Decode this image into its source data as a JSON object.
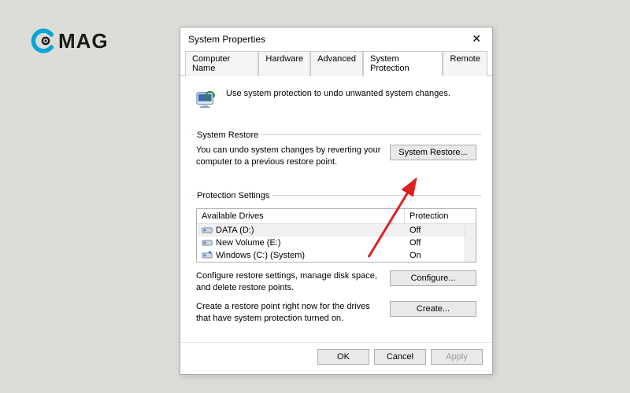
{
  "logo": {
    "text": "MAG"
  },
  "dialog": {
    "title": "System Properties",
    "tabs": [
      "Computer Name",
      "Hardware",
      "Advanced",
      "System Protection",
      "Remote"
    ],
    "active_tab": 3,
    "intro_text": "Use system protection to undo unwanted system changes.",
    "restore": {
      "group_label": "System Restore",
      "description": "You can undo system changes by reverting your computer to a previous restore point.",
      "button": "System Restore..."
    },
    "protection": {
      "group_label": "Protection Settings",
      "header_drives": "Available Drives",
      "header_protection": "Protection",
      "drives": [
        {
          "name": "DATA (D:)",
          "status": "Off",
          "selected": true
        },
        {
          "name": "New Volume (E:)",
          "status": "Off",
          "selected": false
        },
        {
          "name": "Windows (C:) (System)",
          "status": "On",
          "selected": false
        }
      ],
      "configure_text": "Configure restore settings, manage disk space, and delete restore points.",
      "configure_button": "Configure...",
      "create_text": "Create a restore point right now for the drives that have system protection turned on.",
      "create_button": "Create..."
    },
    "footer": {
      "ok": "OK",
      "cancel": "Cancel",
      "apply": "Apply"
    }
  }
}
